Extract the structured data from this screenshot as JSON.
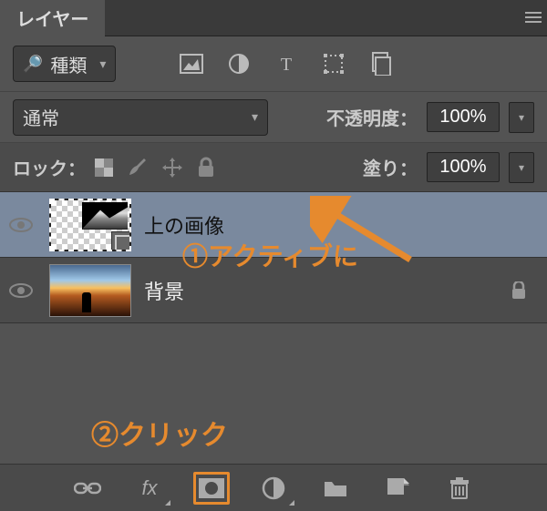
{
  "panel": {
    "title": "レイヤー"
  },
  "filter": {
    "kind_label": "種類"
  },
  "blend": {
    "mode": "通常",
    "opacity_label": "不透明度：",
    "opacity_value": "100%"
  },
  "lock": {
    "label": "ロック：",
    "fill_label": "塗り：",
    "fill_value": "100%"
  },
  "layers": [
    {
      "name": "上の画像",
      "active": true,
      "locked": false
    },
    {
      "name": "背景",
      "active": false,
      "locked": true
    }
  ],
  "annotations": {
    "step1": "①アクティブに",
    "step2": "②クリック"
  },
  "bottom_icons": {
    "link": "link-icon",
    "fx": "fx-icon",
    "mask": "mask-icon",
    "adjustment": "adjustment-icon",
    "folder": "folder-icon",
    "new": "new-layer-icon",
    "trash": "trash-icon"
  }
}
